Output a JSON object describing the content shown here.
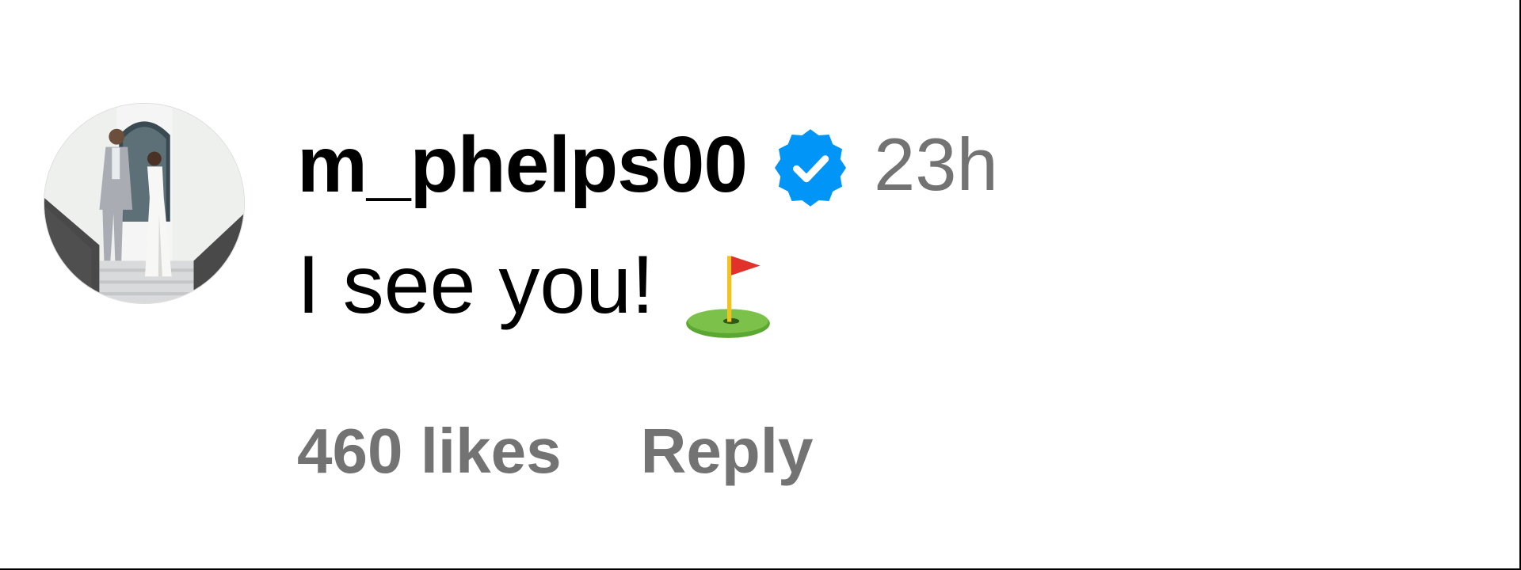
{
  "comment": {
    "avatar_icon": "profile-photo-avatar",
    "username": "m_phelps00",
    "verified_icon": "verified-badge-icon",
    "timestamp": "23h",
    "text": "I see you!",
    "emoji_icon": "flag-in-hole-emoji",
    "likes_label": "460 likes",
    "reply_label": "Reply"
  },
  "colors": {
    "background": "#ffffff",
    "text_primary": "#000000",
    "text_secondary": "#737373",
    "verified_blue": "#0095f6"
  }
}
